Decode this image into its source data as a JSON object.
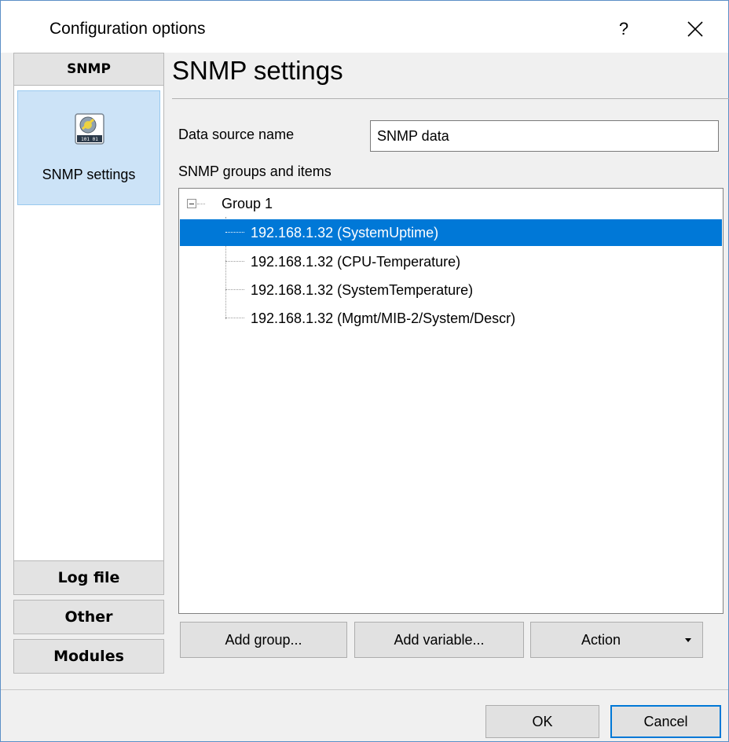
{
  "window": {
    "title": "Configuration options",
    "help_label": "?"
  },
  "nav": {
    "snmp_header": "SNMP",
    "items": [
      {
        "label": "SNMP settings",
        "icon": "snmp-settings-icon"
      }
    ],
    "log_file": "Log file",
    "other": "Other",
    "modules": "Modules"
  },
  "content": {
    "title": "SNMP settings",
    "data_source_label": "Data source name",
    "data_source_value": "SNMP data",
    "groups_label": "SNMP groups and items"
  },
  "tree": {
    "group": "Group 1",
    "items": [
      "192.168.1.32 (SystemUptime)",
      "192.168.1.32 (CPU-Temperature)",
      "192.168.1.32 (SystemTemperature)",
      "192.168.1.32 (Mgmt/MIB-2/System/Descr)"
    ],
    "selected_index": 0
  },
  "buttons": {
    "add_group": "Add group...",
    "add_variable": "Add variable...",
    "action": "Action",
    "ok": "OK",
    "cancel": "Cancel"
  },
  "colors": {
    "selection": "#0078d7",
    "nav_item_bg": "#cce3f7"
  }
}
